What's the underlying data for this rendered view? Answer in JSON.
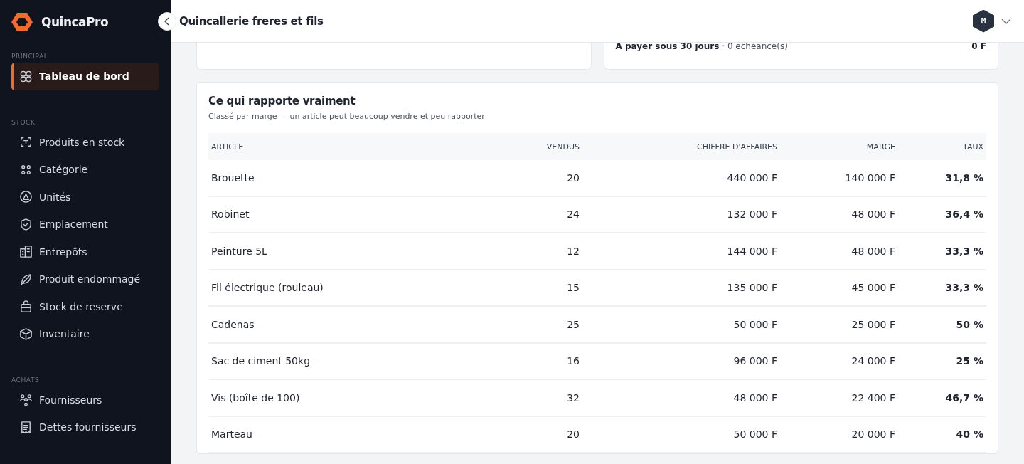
{
  "sidebar": {
    "brand": "QuincaPro",
    "sections": [
      {
        "label": "PRINCIPAL",
        "items": [
          {
            "label": "Tableau de bord",
            "selected": true
          }
        ]
      },
      {
        "label": "STOCK",
        "items": [
          {
            "label": "Produits en stock",
            "selected": false
          },
          {
            "label": "Catégorie",
            "selected": false
          },
          {
            "label": "Unités",
            "selected": false
          },
          {
            "label": "Emplacement",
            "selected": false
          },
          {
            "label": "Entrepôts",
            "selected": false
          },
          {
            "label": "Produit endommagé",
            "selected": false
          },
          {
            "label": "Stock de reserve",
            "selected": false
          },
          {
            "label": "Inventaire",
            "selected": false
          }
        ]
      },
      {
        "label": "ACHATS",
        "items": [
          {
            "label": "Fournisseurs",
            "selected": false
          },
          {
            "label": "Dettes fournisseurs",
            "selected": false
          }
        ]
      }
    ]
  },
  "header": {
    "title": "Quincallerie freres et fils",
    "avatar": "M"
  },
  "payables_card": {
    "text": "**A payer sous 30 jours** · 0 échéance(s)",
    "amount": "0 F"
  },
  "margin_card": {
    "title": "Ce qui rapporte vraiment",
    "subtitle": "Classé par marge — un article peut beaucoup vendre et peu rapporter",
    "columns": [
      "ARTICLE",
      "VENDUS",
      "CHIFFRE D'AFFAIRES",
      "MARGE",
      "TAUX"
    ],
    "rows": [
      [
        "Brouette",
        "20",
        "440 000 F",
        "140 000 F",
        "31,8 %"
      ],
      [
        "Robinet",
        "24",
        "132 000 F",
        "48 000 F",
        "36,4 %"
      ],
      [
        "Peinture 5L",
        "12",
        "144 000 F",
        "48 000 F",
        "33,3 %"
      ],
      [
        "Fil électrique (rouleau)",
        "15",
        "135 000 F",
        "45 000 F",
        "33,3 %"
      ],
      [
        "Cadenas",
        "25",
        "50 000 F",
        "25 000 F",
        "50 %"
      ],
      [
        "Sac de ciment 50kg",
        "16",
        "96 000 F",
        "24 000 F",
        "25 %"
      ],
      [
        "Vis (boîte de 100)",
        "32",
        "48 000 F",
        "22 400 F",
        "46,7 %"
      ],
      [
        "Marteau",
        "20",
        "50 000 F",
        "20 000 F",
        "40 %"
      ]
    ]
  }
}
